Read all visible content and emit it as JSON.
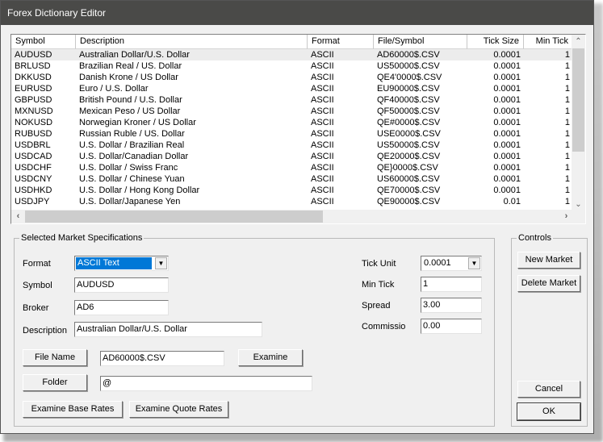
{
  "window": {
    "title": "Forex Dictionary Editor"
  },
  "list": {
    "columns": [
      "Symbol",
      "Description",
      "Format",
      "File/Symbol",
      "Tick Size",
      "Min Tick"
    ],
    "rows": [
      {
        "symbol": "AUDUSD",
        "description": "Australian Dollar/U.S. Dollar",
        "format": "ASCII",
        "file": "AD60000$.CSV",
        "tick_size": "0.0001",
        "min_tick": "1",
        "selected": true
      },
      {
        "symbol": "BRLUSD",
        "description": "Brazilian Real / US. Dollar",
        "format": "ASCII",
        "file": "US50000$.CSV",
        "tick_size": "0.0001",
        "min_tick": "1"
      },
      {
        "symbol": "DKKUSD",
        "description": "Danish Krone / US Dollar",
        "format": "ASCII",
        "file": "QE4'0000$.CSV",
        "tick_size": "0.0001",
        "min_tick": "1"
      },
      {
        "symbol": "EURUSD",
        "description": "Euro / U.S. Dollar",
        "format": "ASCII",
        "file": "EU90000$.CSV",
        "tick_size": "0.0001",
        "min_tick": "1"
      },
      {
        "symbol": "GBPUSD",
        "description": "British Pound / U.S. Dollar",
        "format": "ASCII",
        "file": "QF40000$.CSV",
        "tick_size": "0.0001",
        "min_tick": "1"
      },
      {
        "symbol": "MXNUSD",
        "description": "Mexican Peso / US Dollar",
        "format": "ASCII",
        "file": "QF50000$.CSV",
        "tick_size": "0.0001",
        "min_tick": "1"
      },
      {
        "symbol": "NOKUSD",
        "description": "Norwegian Kroner / US Dollar",
        "format": "ASCII",
        "file": "QE#0000$.CSV",
        "tick_size": "0.0001",
        "min_tick": "1"
      },
      {
        "symbol": "RUBUSD",
        "description": "Russian Ruble / US. Dollar",
        "format": "ASCII",
        "file": "USE0000$.CSV",
        "tick_size": "0.0001",
        "min_tick": "1"
      },
      {
        "symbol": "USDBRL",
        "description": "U.S. Dollar / Brazilian Real",
        "format": "ASCII",
        "file": "US50000$.CSV",
        "tick_size": "0.0001",
        "min_tick": "1"
      },
      {
        "symbol": "USDCAD",
        "description": "U.S. Dollar/Canadian Dollar",
        "format": "ASCII",
        "file": "QE20000$.CSV",
        "tick_size": "0.0001",
        "min_tick": "1"
      },
      {
        "symbol": "USDCHF",
        "description": "U.S. Dollar / Swiss Franc",
        "format": "ASCII",
        "file": "QE}0000$.CSV",
        "tick_size": "0.0001",
        "min_tick": "1"
      },
      {
        "symbol": "USDCNY",
        "description": "U.S. Dollar / Chinese Yuan",
        "format": "ASCII",
        "file": "US60000$.CSV",
        "tick_size": "0.0001",
        "min_tick": "1"
      },
      {
        "symbol": "USDHKD",
        "description": "U.S. Dollar / Hong Kong Dollar",
        "format": "ASCII",
        "file": "QE70000$.CSV",
        "tick_size": "0.0001",
        "min_tick": "1"
      },
      {
        "symbol": "USDJPY",
        "description": " U.S. Dollar/Japanese Yen",
        "format": "ASCII",
        "file": "QE90000$.CSV",
        "tick_size": "0.01",
        "min_tick": "1"
      }
    ],
    "scroll_icons": {
      "up": "chevron-up-icon",
      "down": "chevron-down-icon",
      "left": "chevron-left-icon",
      "right": "chevron-right-icon"
    }
  },
  "spec": {
    "group_label": "Selected Market Specifications",
    "format_label": "Format",
    "format_value": "ASCII Text",
    "symbol_label": "Symbol",
    "symbol_value": "AUDUSD",
    "broker_label": "Broker",
    "broker_value": "AD6",
    "description_label": "Description",
    "description_value": "Australian Dollar/U.S. Dollar",
    "tick_unit_label": "Tick Unit",
    "tick_unit_value": "0.0001",
    "min_tick_label": "Min Tick",
    "min_tick_value": "1",
    "spread_label": "Spread",
    "spread_value": "3.00",
    "commission_label": "Commissio",
    "commission_value": "0.00",
    "file_name_button": "File Name",
    "file_name_value": "AD60000$.CSV",
    "examine_button": "Examine",
    "folder_button": "Folder",
    "folder_value": "@",
    "examine_base_button": "Examine Base Rates",
    "examine_quote_button": "Examine  Quote Rates"
  },
  "controls": {
    "group_label": "Controls",
    "new_market": "New Market",
    "delete_market": "Delete Market",
    "cancel": "Cancel",
    "ok": "OK"
  }
}
